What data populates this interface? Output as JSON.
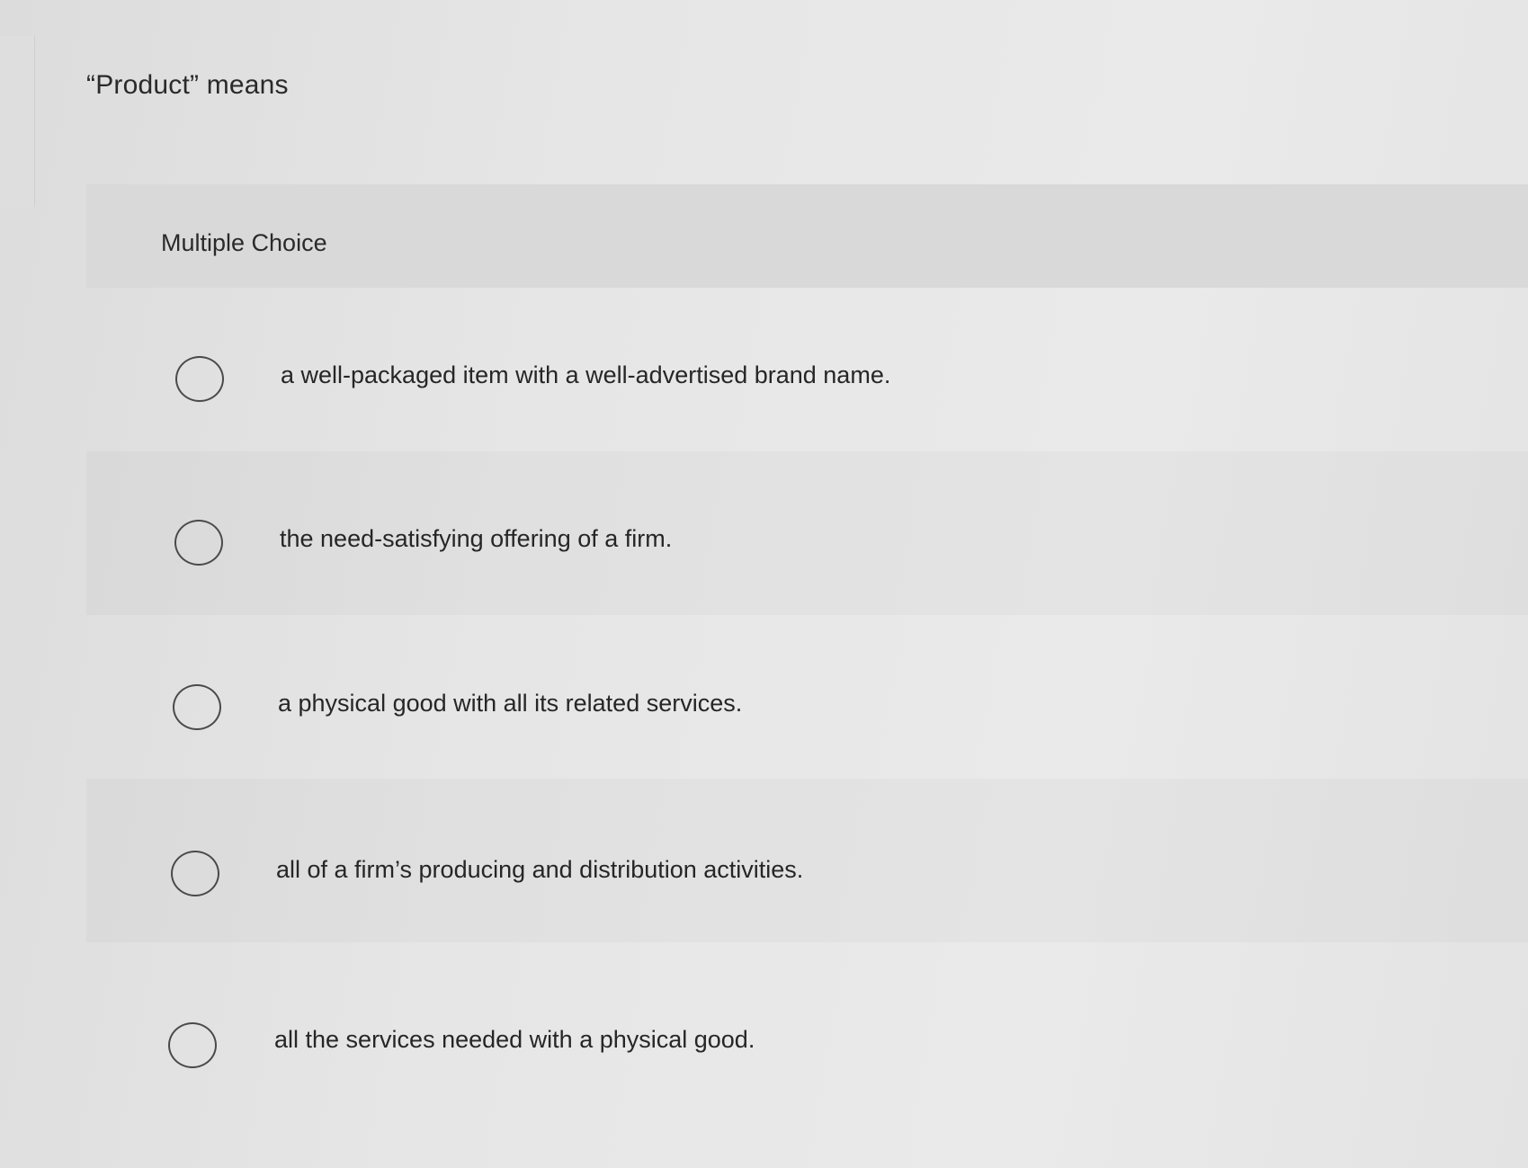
{
  "question": {
    "text": "“Product” means"
  },
  "section": {
    "title": "Multiple Choice"
  },
  "options": [
    {
      "label": "a well-packaged item with a well-advertised brand name."
    },
    {
      "label": "the need-satisfying offering of a firm."
    },
    {
      "label": "a physical good with all its related services."
    },
    {
      "label": "all of a firm’s producing and distribution activities."
    },
    {
      "label": "all the services needed with a physical good."
    }
  ]
}
